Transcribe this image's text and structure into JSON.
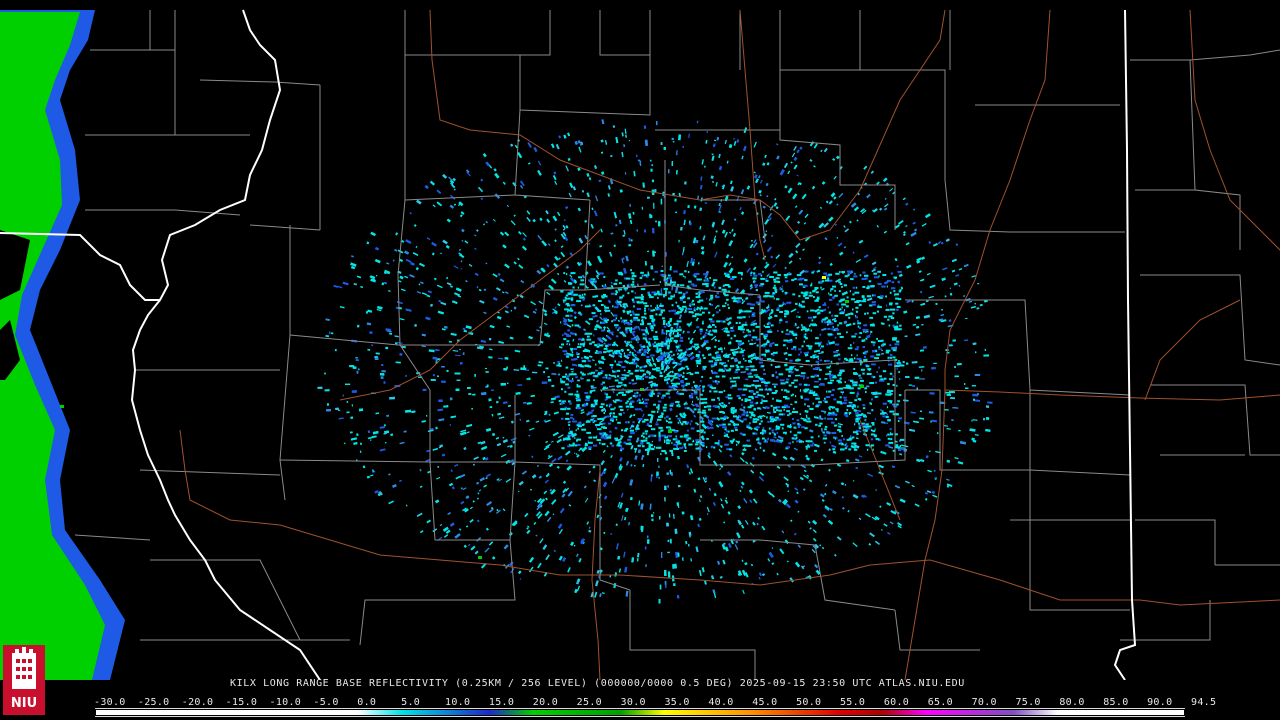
{
  "product": {
    "caption": "KILX LONG RANGE BASE REFLECTIVITY (0.25KM / 256 LEVEL) (000000/0000 0.5 DEG) 2025-09-15 23:50 UTC  ATLAS.NIU.EDU"
  },
  "logo": {
    "text": "NIU",
    "icon": "niu-tower-logo-icon",
    "color": "#c8102e"
  },
  "legend": {
    "ticks": [
      "-30.0",
      "-25.0",
      "-20.0",
      "-15.0",
      "-10.0",
      "-5.0",
      "0.0",
      "5.0",
      "10.0",
      "15.0",
      "20.0",
      "25.0",
      "30.0",
      "35.0",
      "40.0",
      "45.0",
      "50.0",
      "55.0",
      "60.0",
      "65.0",
      "70.0",
      "75.0",
      "80.0",
      "85.0",
      "90.0",
      "94.5"
    ],
    "color_stops": [
      {
        "value": -30,
        "color": "#ffffff"
      },
      {
        "value": 0,
        "color": "#ffffff"
      },
      {
        "value": 5,
        "color": "#00e5e5"
      },
      {
        "value": 15,
        "color": "#1e28c8"
      },
      {
        "value": 20,
        "color": "#00d000"
      },
      {
        "value": 30,
        "color": "#00a000"
      },
      {
        "value": 35,
        "color": "#ffff00"
      },
      {
        "value": 45,
        "color": "#ff9000"
      },
      {
        "value": 55,
        "color": "#e00000"
      },
      {
        "value": 60,
        "color": "#b00000"
      },
      {
        "value": 65,
        "color": "#ff00ff"
      },
      {
        "value": 75,
        "color": "#8050c0"
      },
      {
        "value": 80,
        "color": "#ffffff"
      },
      {
        "value": 94.5,
        "color": "#ffffff"
      }
    ]
  },
  "map_colors": {
    "background": "#000000",
    "county_lines": "#8a8a8a",
    "state_lines": "#ffffff",
    "highways": "#a0522d",
    "echo_light": "#00e5e5",
    "echo_mid": "#1e5ae6",
    "echo_strong": "#00d000"
  }
}
